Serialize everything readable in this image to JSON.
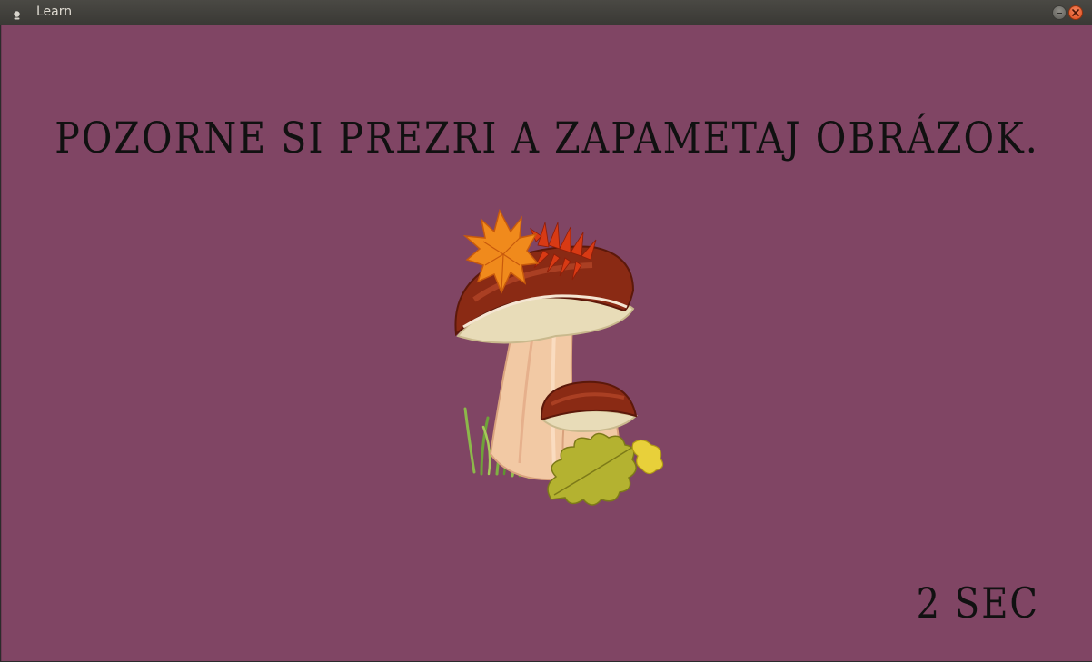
{
  "window": {
    "title": "Learn"
  },
  "main": {
    "instruction": "POZORNE SI PREZRI A ZAPAMETAJ OBRÁZOK.",
    "timer": "2 SEC",
    "image_subject": "mushrooms-with-autumn-leaves",
    "background_color": "#804564"
  }
}
